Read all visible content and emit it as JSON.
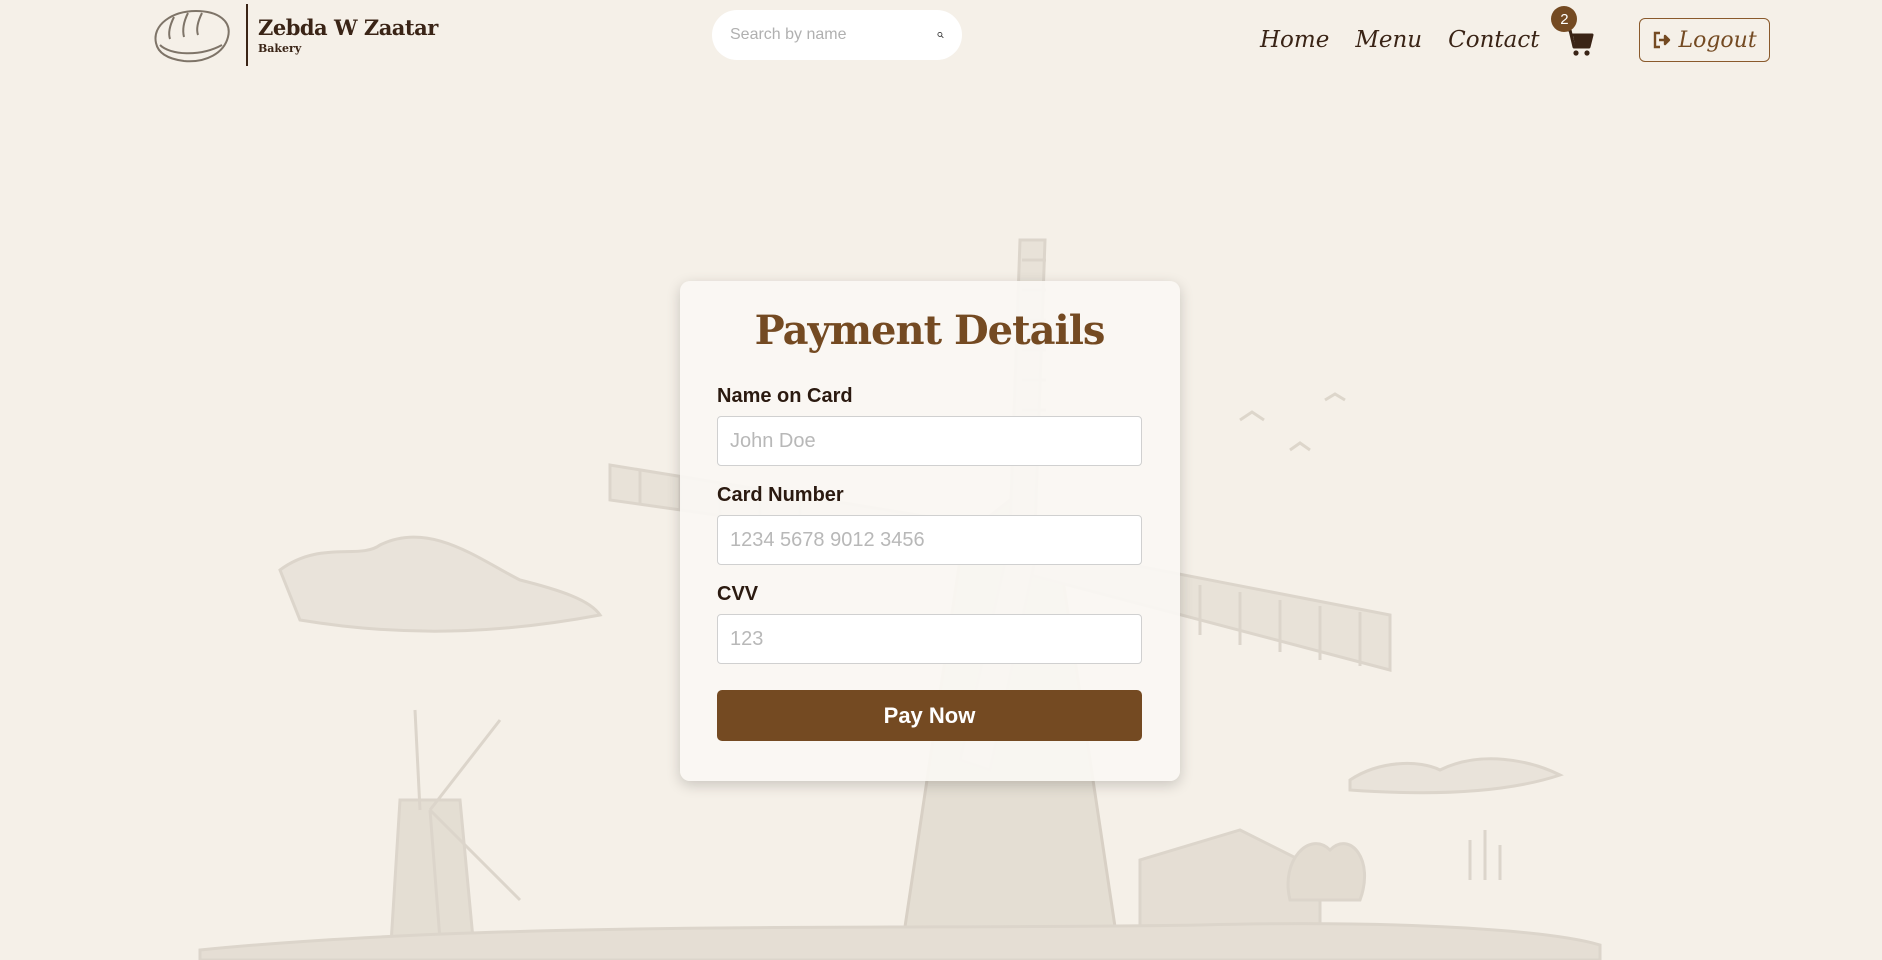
{
  "brand": {
    "name": "Zebda W Zaatar",
    "subtitle": "Bakery"
  },
  "search": {
    "placeholder": "Search by name",
    "value": ""
  },
  "nav": {
    "links": [
      "Home",
      "Menu",
      "Contact"
    ],
    "cart_count": "2",
    "logout_label": "Logout"
  },
  "payment": {
    "title": "Payment Details",
    "fields": [
      {
        "label": "Name on Card",
        "placeholder": "John Doe",
        "value": ""
      },
      {
        "label": "Card Number",
        "placeholder": "1234 5678 9012 3456",
        "value": ""
      },
      {
        "label": "CVV",
        "placeholder": "123",
        "value": ""
      }
    ],
    "submit_label": "Pay Now"
  },
  "colors": {
    "accent": "#744a22",
    "background": "#f5f0e8",
    "text": "#3a2416"
  },
  "icons": [
    "bread-logo-icon",
    "search-icon",
    "cart-icon",
    "logout-icon"
  ]
}
